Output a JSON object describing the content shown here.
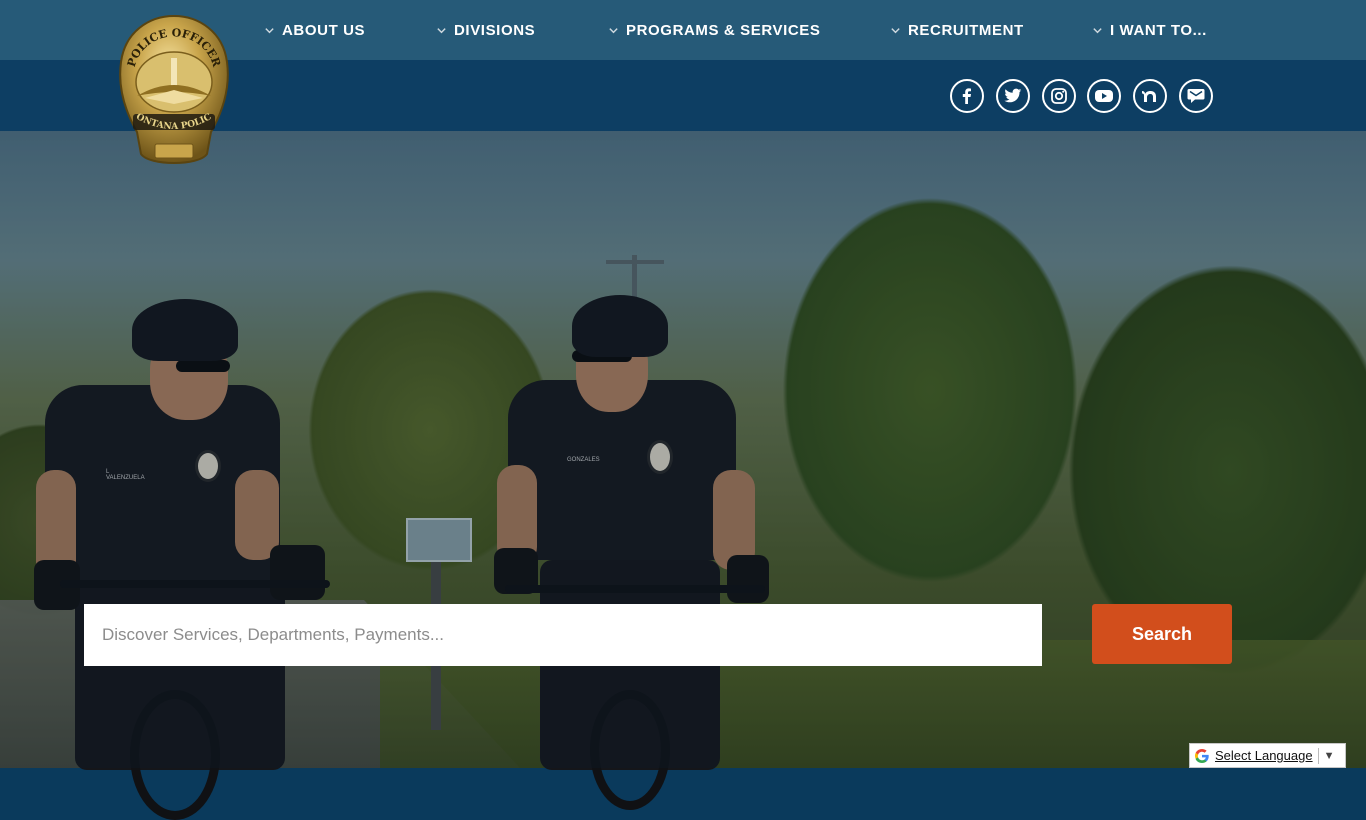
{
  "nav": {
    "items": [
      {
        "label": "ABOUT US",
        "icon": "chevron-down-icon"
      },
      {
        "label": "DIVISIONS",
        "icon": "chevron-down-icon"
      },
      {
        "label": "PROGRAMS & SERVICES",
        "icon": "chevron-down-icon"
      },
      {
        "label": "RECRUITMENT",
        "icon": "chevron-down-icon"
      },
      {
        "label": "I WANT TO...",
        "icon": "chevron-down-icon"
      }
    ]
  },
  "logo": {
    "top_text": "POLICE OFFICER",
    "bottom_text": "FONTANA POLICE"
  },
  "social": [
    "facebook-icon",
    "twitter-icon",
    "instagram-icon",
    "youtube-icon",
    "nextdoor-icon",
    "newsletter-icon"
  ],
  "hero": {
    "officer_left_name": "L VALENZUELA",
    "officer_right_name": "GONZALES"
  },
  "search": {
    "placeholder": "Discover Services, Departments, Payments...",
    "button_label": "Search"
  },
  "translate": {
    "label": "Select Language",
    "arrow": "▼"
  },
  "colors": {
    "topbar": "#265a78",
    "subbar": "#0d3e63",
    "search_button": "#d24e1c"
  }
}
